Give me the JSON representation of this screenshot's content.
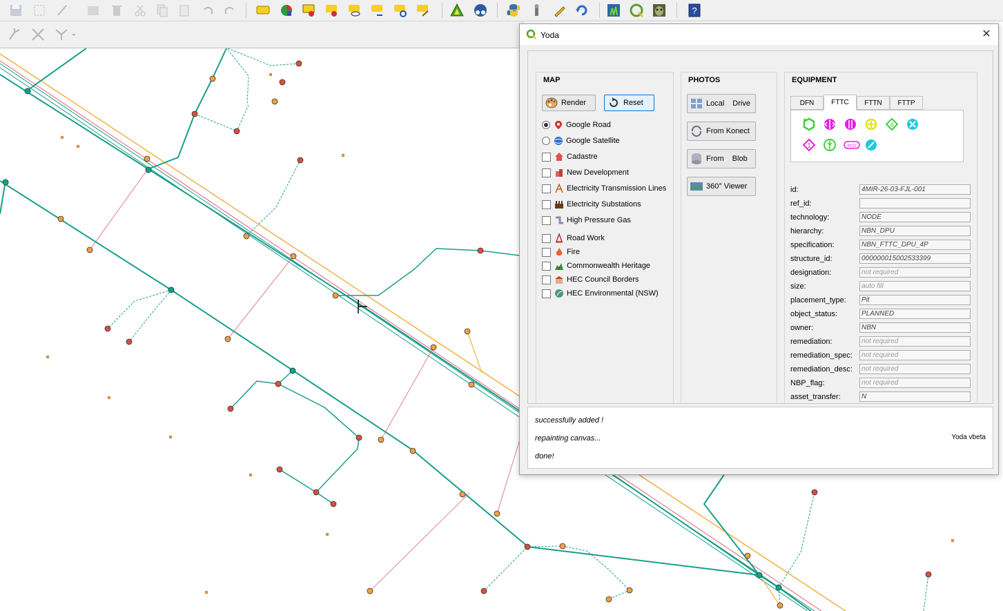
{
  "toolbar": {
    "icons": [
      "save-icon",
      "select-features-icon",
      "edit-feature-icon",
      "digitize-icon",
      "delete-icon",
      "cut-icon",
      "copy-icon",
      "paste-icon",
      "undo-icon",
      "redo-icon",
      "label-icon",
      "pie-diagram-icon",
      "label-pin-icon",
      "label-highlight-icon",
      "label-show-icon",
      "label-move-icon",
      "label-rotate-icon",
      "label-change-icon",
      "triangle-layer-icon",
      "lens-icon",
      "python-icon",
      "plugin-icon",
      "pencil-icon",
      "refresh-icon",
      "grass-icon",
      "qgis-icon",
      "yoda-icon",
      "help-icon"
    ]
  },
  "dialog": {
    "title": "Yoda",
    "close_glyph": "✕",
    "map": {
      "heading": "MAP",
      "render_label": "Render",
      "reset_label": "Reset",
      "basemaps": [
        {
          "label": "Google Road",
          "selected": true
        },
        {
          "label": "Google Satellite",
          "selected": false
        }
      ],
      "layers": [
        "Cadastre",
        "New Development",
        "Electricity Transmission Lines",
        "Electricity Substations",
        "High Pressure Gas",
        "Road Work",
        "Fire",
        "Commonwealth Heritage",
        "HEC Council Borders",
        "HEC Environmental (NSW)"
      ]
    },
    "photos": {
      "heading": "PHOTOS",
      "local_label": "Local",
      "drive_label": "Drive",
      "konect_label": "From Konect",
      "blob_from_label": "From",
      "blob_label": "Blob",
      "viewer_label": "360° Viewer"
    },
    "equipment": {
      "heading": "EQUIPMENT",
      "tabs": [
        "DFN",
        "FTTC",
        "FTTN",
        "FTTP"
      ],
      "active_tab": "FTTC",
      "pcd_text": "PCD",
      "four_text": "4",
      "one_text": "1",
      "fields": [
        {
          "label": "id:",
          "value": "4MIR-26-03-FJL-001",
          "placeholder": false
        },
        {
          "label": "ref_id:",
          "value": "",
          "placeholder": false
        },
        {
          "label": "technology:",
          "value": "NODE",
          "placeholder": false
        },
        {
          "label": "hierarchy:",
          "value": "NBN_DPU",
          "placeholder": false
        },
        {
          "label": "specification:",
          "value": "NBN_FTTC_DPU_4P",
          "placeholder": false
        },
        {
          "label": "structure_id:",
          "value": "000000015002533399",
          "placeholder": false
        },
        {
          "label": "designation:",
          "value": "not required",
          "placeholder": true
        },
        {
          "label": "size:",
          "value": "auto fill",
          "placeholder": true
        },
        {
          "label": "placement_type:",
          "value": "Pit",
          "placeholder": false
        },
        {
          "label": "object_status:",
          "value": "PLANNED",
          "placeholder": false
        },
        {
          "label": "owner:",
          "value": "NBN",
          "placeholder": false
        },
        {
          "label": "remediation:",
          "value": "not required",
          "placeholder": true
        },
        {
          "label": "remediation_spec:",
          "value": "not required",
          "placeholder": true
        },
        {
          "label": "remediation_desc:",
          "value": "not required",
          "placeholder": true
        },
        {
          "label": "NBP_flag:",
          "value": "not required",
          "placeholder": true
        },
        {
          "label": "asset_transfer:",
          "value": "N",
          "placeholder": false
        }
      ]
    },
    "log": {
      "lines": [
        "successfully added !",
        "repainting canvas...",
        "done!"
      ],
      "version": "Yoda vbeta"
    }
  },
  "colors": {
    "network_green": "#1a9e8a",
    "road_orange": "#f0a020",
    "boundary_pink": "#e0607a",
    "node_orange": "#f0a040",
    "node_red": "#d94f3f",
    "accent_magenta": "#e020e0",
    "accent_cyan": "#20c8e0",
    "accent_green": "#40d040"
  }
}
